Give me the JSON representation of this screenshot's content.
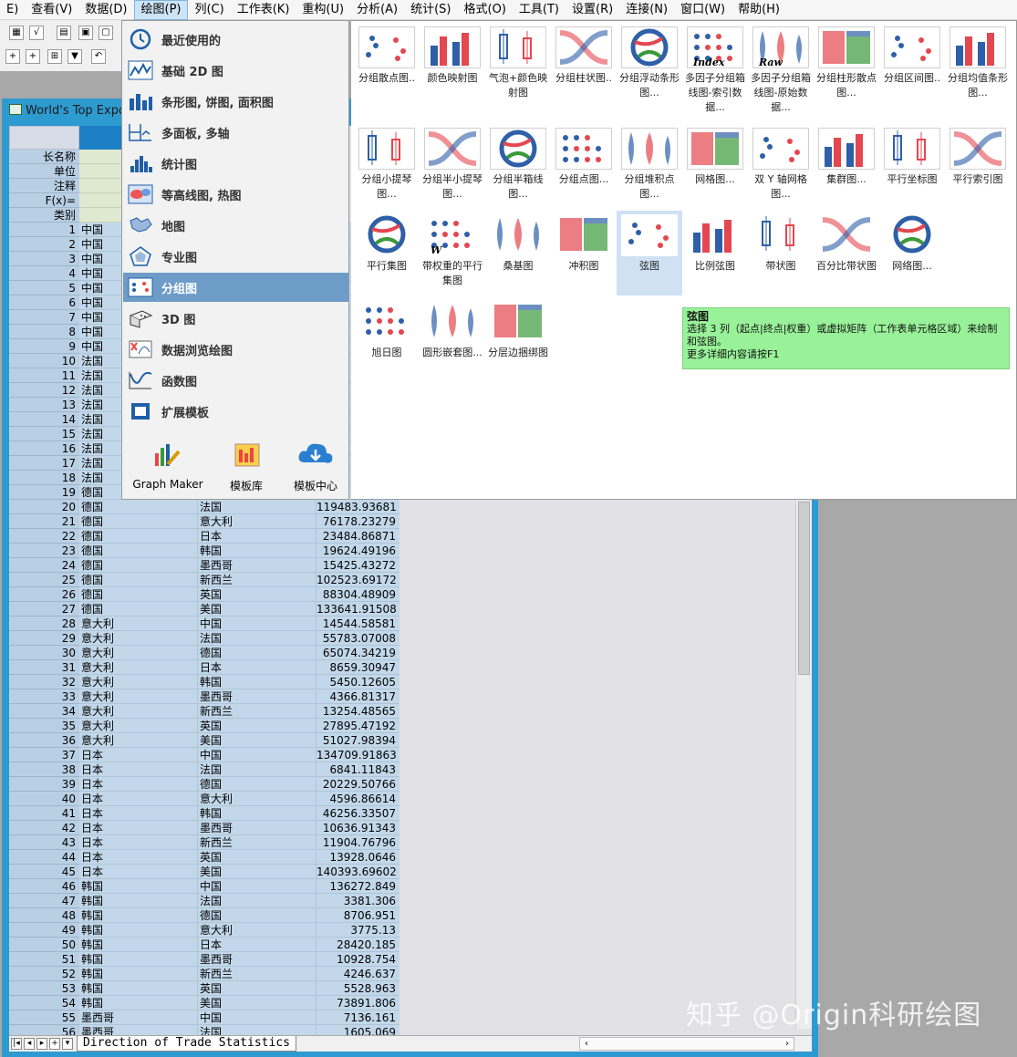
{
  "menubar": {
    "items": [
      "E)",
      "查看(V)",
      "数据(D)",
      "绘图(P)",
      "列(C)",
      "工作表(K)",
      "重构(U)",
      "分析(A)",
      "统计(S)",
      "格式(O)",
      "工具(T)",
      "设置(R)",
      "连接(N)",
      "窗口(W)",
      "帮助(H)"
    ],
    "active_index": 3
  },
  "workbook": {
    "title": "World's Top Expo",
    "prop_labels": [
      "长名称",
      "单位",
      "注释",
      "F(x)=",
      "类别"
    ],
    "rows": [
      [
        "1",
        "中国",
        "",
        ""
      ],
      [
        "2",
        "中国",
        "",
        ""
      ],
      [
        "3",
        "中国",
        "",
        ""
      ],
      [
        "4",
        "中国",
        "",
        ""
      ],
      [
        "5",
        "中国",
        "",
        ""
      ],
      [
        "6",
        "中国",
        "",
        ""
      ],
      [
        "7",
        "中国",
        "",
        ""
      ],
      [
        "8",
        "中国",
        "",
        ""
      ],
      [
        "9",
        "中国",
        "",
        ""
      ],
      [
        "10",
        "法国",
        "",
        ""
      ],
      [
        "11",
        "法国",
        "",
        ""
      ],
      [
        "12",
        "法国",
        "",
        ""
      ],
      [
        "13",
        "法国",
        "",
        ""
      ],
      [
        "14",
        "法国",
        "",
        ""
      ],
      [
        "15",
        "法国",
        "",
        ""
      ],
      [
        "16",
        "法国",
        "",
        ""
      ],
      [
        "17",
        "法国",
        "",
        ""
      ],
      [
        "18",
        "法国",
        "",
        ""
      ],
      [
        "19",
        "德国",
        "",
        ""
      ],
      [
        "20",
        "德国",
        "法国",
        "119483.93681"
      ],
      [
        "21",
        "德国",
        "意大利",
        "76178.23279"
      ],
      [
        "22",
        "德国",
        "日本",
        "23484.86871"
      ],
      [
        "23",
        "德国",
        "韩国",
        "19624.49196"
      ],
      [
        "24",
        "德国",
        "墨西哥",
        "15425.43272"
      ],
      [
        "25",
        "德国",
        "新西兰",
        "102523.69172"
      ],
      [
        "26",
        "德国",
        "英国",
        "88304.48909"
      ],
      [
        "27",
        "德国",
        "美国",
        "133641.91508"
      ],
      [
        "28",
        "意大利",
        "中国",
        "14544.58581"
      ],
      [
        "29",
        "意大利",
        "法国",
        "55783.07008"
      ],
      [
        "30",
        "意大利",
        "德国",
        "65074.34219"
      ],
      [
        "31",
        "意大利",
        "日本",
        "8659.30947"
      ],
      [
        "32",
        "意大利",
        "韩国",
        "5450.12605"
      ],
      [
        "33",
        "意大利",
        "墨西哥",
        "4366.81317"
      ],
      [
        "34",
        "意大利",
        "新西兰",
        "13254.48565"
      ],
      [
        "35",
        "意大利",
        "英国",
        "27895.47192"
      ],
      [
        "36",
        "意大利",
        "美国",
        "51027.98394"
      ],
      [
        "37",
        "日本",
        "中国",
        "134709.91863"
      ],
      [
        "38",
        "日本",
        "法国",
        "6841.11843"
      ],
      [
        "39",
        "日本",
        "德国",
        "20229.50766"
      ],
      [
        "40",
        "日本",
        "意大利",
        "4596.86614"
      ],
      [
        "41",
        "日本",
        "韩国",
        "46256.33507"
      ],
      [
        "42",
        "日本",
        "墨西哥",
        "10636.91343"
      ],
      [
        "43",
        "日本",
        "新西兰",
        "11904.76796"
      ],
      [
        "44",
        "日本",
        "英国",
        "13928.0646"
      ],
      [
        "45",
        "日本",
        "美国",
        "140393.69602"
      ],
      [
        "46",
        "韩国",
        "中国",
        "136272.849"
      ],
      [
        "47",
        "韩国",
        "法国",
        "3381.306"
      ],
      [
        "48",
        "韩国",
        "德国",
        "8706.951"
      ],
      [
        "49",
        "韩国",
        "意大利",
        "3775.13"
      ],
      [
        "50",
        "韩国",
        "日本",
        "28420.185"
      ],
      [
        "51",
        "韩国",
        "墨西哥",
        "10928.754"
      ],
      [
        "52",
        "韩国",
        "新西兰",
        "4246.637"
      ],
      [
        "53",
        "韩国",
        "英国",
        "5528.963"
      ],
      [
        "54",
        "韩国",
        "美国",
        "73891.806"
      ],
      [
        "55",
        "墨西哥",
        "中国",
        "7136.161"
      ],
      [
        "56",
        "墨西哥",
        "法国",
        "1605.069"
      ]
    ],
    "sheet_tab": "Direction of Trade Statistics"
  },
  "plot_menu": {
    "items": [
      {
        "label": "最近使用的",
        "icon": "recent-clock-icon"
      },
      {
        "label": "基础 2D 图",
        "icon": "line-2d-icon"
      },
      {
        "label": "条形图, 饼图, 面积图",
        "icon": "bar-chart-icon"
      },
      {
        "label": "多面板, 多轴",
        "icon": "multi-panel-icon"
      },
      {
        "label": "统计图",
        "icon": "histogram-icon"
      },
      {
        "label": "等高线图, 热图",
        "icon": "contour-icon"
      },
      {
        "label": "地图",
        "icon": "map-icon"
      },
      {
        "label": "专业图",
        "icon": "polar-icon"
      },
      {
        "label": "分组图",
        "icon": "grouped-plot-icon"
      },
      {
        "label": "3D 图",
        "icon": "3d-icon"
      },
      {
        "label": "数据浏览绘图",
        "icon": "data-explore-icon"
      },
      {
        "label": "函数图",
        "icon": "function-plot-icon"
      },
      {
        "label": "扩展模板",
        "icon": "extension-template-icon"
      }
    ],
    "selected_index": 8,
    "bottom_tools": [
      "Graph Maker",
      "模板库",
      "模板中心"
    ]
  },
  "gallery": {
    "items": [
      "分组散点图..",
      "颜色映射图",
      "气泡+颜色映射图",
      "分组柱状图..",
      "分组浮动条形图...",
      "多因子分组箱线图-索引数据...",
      "多因子分组箱线图-原始数据...",
      "分组柱形散点图...",
      "分组区间图..",
      "分组均值条形图...",
      "分组小提琴图...",
      "分组半小提琴图...",
      "分组半箱线图...",
      "分组点图...",
      "分组堆积点图...",
      "网格图...",
      "双 Y 轴网格图...",
      "集群图...",
      "平行坐标图",
      "平行索引图",
      "平行集图",
      "带权重的平行集图",
      "桑基图",
      "冲积图",
      "弦图",
      "比例弦图",
      "带状图",
      "百分比带状图",
      "网络图...",
      "旭日图",
      "圆形嵌套图...",
      "分层边捆绑图"
    ],
    "thumb_index_label": "Index",
    "thumb_raw_label": "Raw",
    "thumb_w_label": "W",
    "highlight_index": 24
  },
  "tooltip": {
    "title": "弦图",
    "body": "选择 3 列（起点|终点|权重）或虚拟矩阵（工作表单元格区域）来绘制和弦图。",
    "more": "更多详细内容请按F1"
  },
  "watermark": "知乎 @Origin科研绘图",
  "colors": {
    "accent_blue": "#2e9bd0",
    "menu_selected": "#6e9cc8",
    "tooltip_bg": "#99f299",
    "row_bg": "#c2d8ea"
  }
}
